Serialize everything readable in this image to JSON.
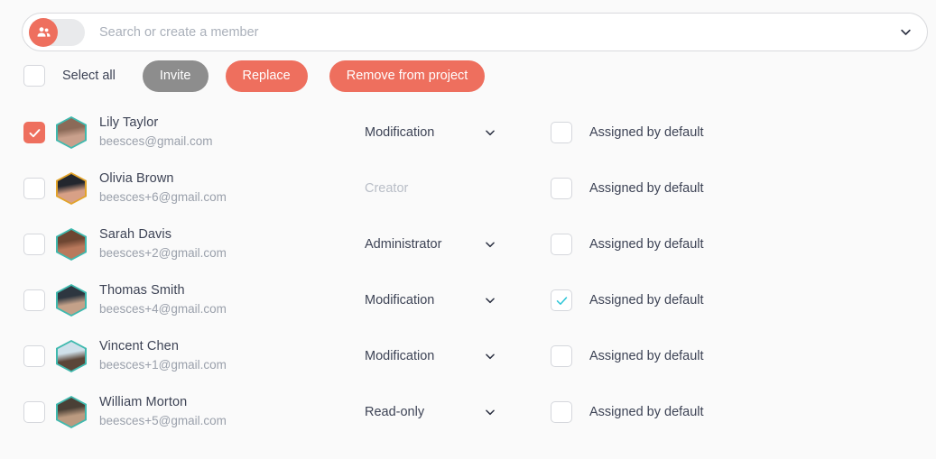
{
  "colors": {
    "accent": "#ee6f5e",
    "disabled_button": "#8d8d8d",
    "check_teal": "#2fc6d8",
    "avatar_border_teal": "#3fb9ae",
    "avatar_border_gold": "#e2a32a",
    "page_background": "#fafafa",
    "text_primary": "#3d4355",
    "text_muted": "#9aa0ab"
  },
  "search": {
    "placeholder": "Search or create a member",
    "value": "",
    "toggle_icon": "people-icon",
    "toggle_on": true,
    "dropdown_icon": "chevron-down-icon"
  },
  "toolbar": {
    "select_all_checked": false,
    "select_all_label": "Select all",
    "invite_label": "Invite",
    "invite_disabled": true,
    "replace_label": "Replace",
    "remove_label": "Remove from project"
  },
  "assign_label": "Assigned by default",
  "members": [
    {
      "name": "Lily Taylor",
      "email": "beesces@gmail.com",
      "selected": true,
      "role": "Modification",
      "role_editable": true,
      "assigned_by_default": false,
      "avatar_border": "#3fb9ae",
      "avatar_top": "#8b6a58",
      "avatar_bottom": "#c9a08c"
    },
    {
      "name": "Olivia Brown",
      "email": "beesces+6@gmail.com",
      "selected": false,
      "role": "Creator",
      "role_editable": false,
      "assigned_by_default": false,
      "avatar_border": "#e2a32a",
      "avatar_top": "#23272e",
      "avatar_bottom": "#d8a086"
    },
    {
      "name": "Sarah Davis",
      "email": "beesces+2@gmail.com",
      "selected": false,
      "role": "Administrator",
      "role_editable": true,
      "assigned_by_default": false,
      "avatar_border": "#3fb9ae",
      "avatar_top": "#6d4632",
      "avatar_bottom": "#b9795c"
    },
    {
      "name": "Thomas Smith",
      "email": "beesces+4@gmail.com",
      "selected": false,
      "role": "Modification",
      "role_editable": true,
      "assigned_by_default": true,
      "avatar_border": "#3fb9ae",
      "avatar_top": "#2e3640",
      "avatar_bottom": "#c4a189"
    },
    {
      "name": "Vincent Chen",
      "email": "beesces+1@gmail.com",
      "selected": false,
      "role": "Modification",
      "role_editable": true,
      "assigned_by_default": false,
      "avatar_border": "#3fb9ae",
      "avatar_top": "#cfe0ea",
      "avatar_bottom": "#5b4638"
    },
    {
      "name": "William Morton",
      "email": "beesces+5@gmail.com",
      "selected": false,
      "role": "Read-only",
      "role_editable": true,
      "assigned_by_default": false,
      "avatar_border": "#3fb9ae",
      "avatar_top": "#4a4036",
      "avatar_bottom": "#bb9a80"
    }
  ]
}
